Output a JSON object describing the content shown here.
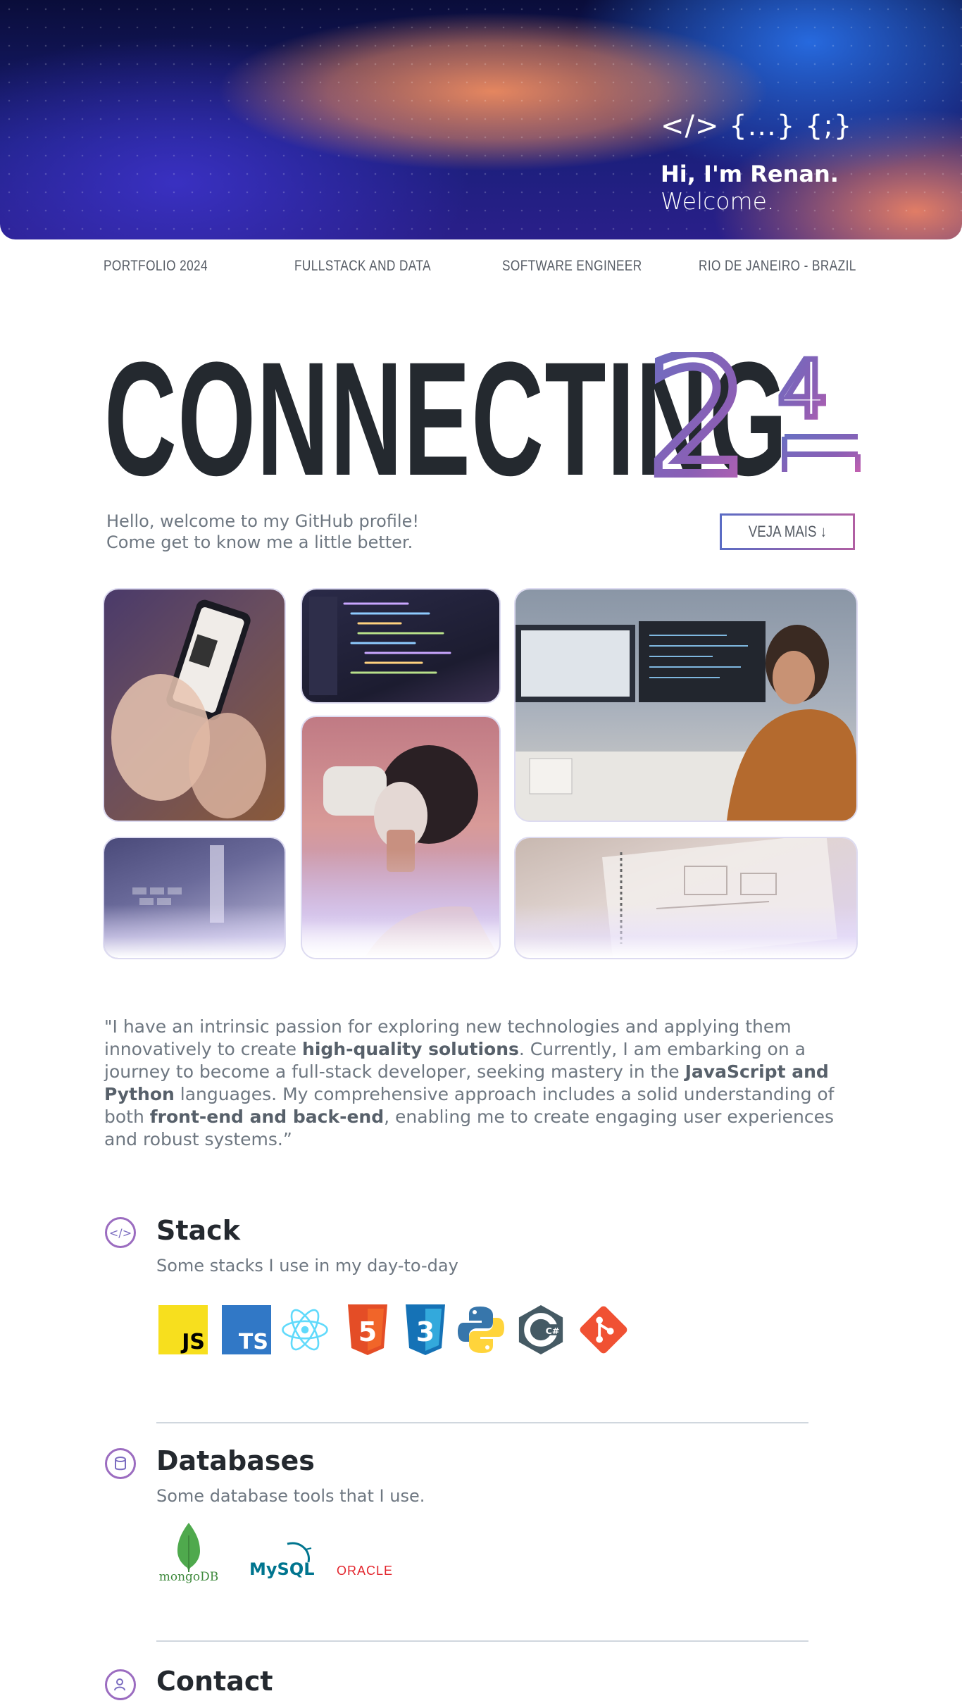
{
  "hero": {
    "code_symbols": "</> {...} {;}",
    "greeting": "Hi, I'm Renan.",
    "welcome": "Welcome."
  },
  "subnav": [
    "PORTFOLIO 2024",
    "FULLSTACK AND DATA",
    "SOFTWARE ENGINEER",
    "RIO DE JANEIRO - BRAZIL"
  ],
  "headline": {
    "word": "CONNECTING",
    "year_big": "2",
    "year_small": "4"
  },
  "intro": {
    "line1": "Hello, welcome to my GitHub profile!",
    "line2": "Come get to know me a little better."
  },
  "cta": {
    "label": "VEJA MAIS ↓"
  },
  "quote": {
    "p1": "\"I have an intrinsic passion for exploring new technologies and applying them innovatively to create ",
    "b1": "high-quality solutions",
    "p2": ". Currently, I am embarking on a journey to become a full-stack developer, seeking mastery in the ",
    "b2": "JavaScript and Python",
    "p3": " languages. My comprehensive approach includes a solid understanding of both ",
    "b3": "front-end and back-end",
    "p4": ", enabling me to create engaging user experiences and robust systems.”"
  },
  "stack": {
    "title": "Stack",
    "subtitle": "Some stacks I use in my day-to-day",
    "icons": [
      "javascript-icon",
      "typescript-icon",
      "react-icon",
      "html5-icon",
      "css3-icon",
      "python-icon",
      "csharp-icon",
      "git-icon"
    ],
    "js_label": "JS",
    "ts_label": "TS",
    "html_label": "5",
    "css_label": "3",
    "cs_label": "C#"
  },
  "databases": {
    "title": "Databases",
    "subtitle": "Some database tools that I use.",
    "mongodb": "mongoDB",
    "mysql": "MySQL",
    "oracle": "ORACLE"
  },
  "contact": {
    "title": "Contact"
  },
  "colors": {
    "accent_blue": "#5b6cc4",
    "accent_purple": "#b05fa3",
    "text_dark": "#24292f",
    "text_muted": "#6e7781"
  }
}
